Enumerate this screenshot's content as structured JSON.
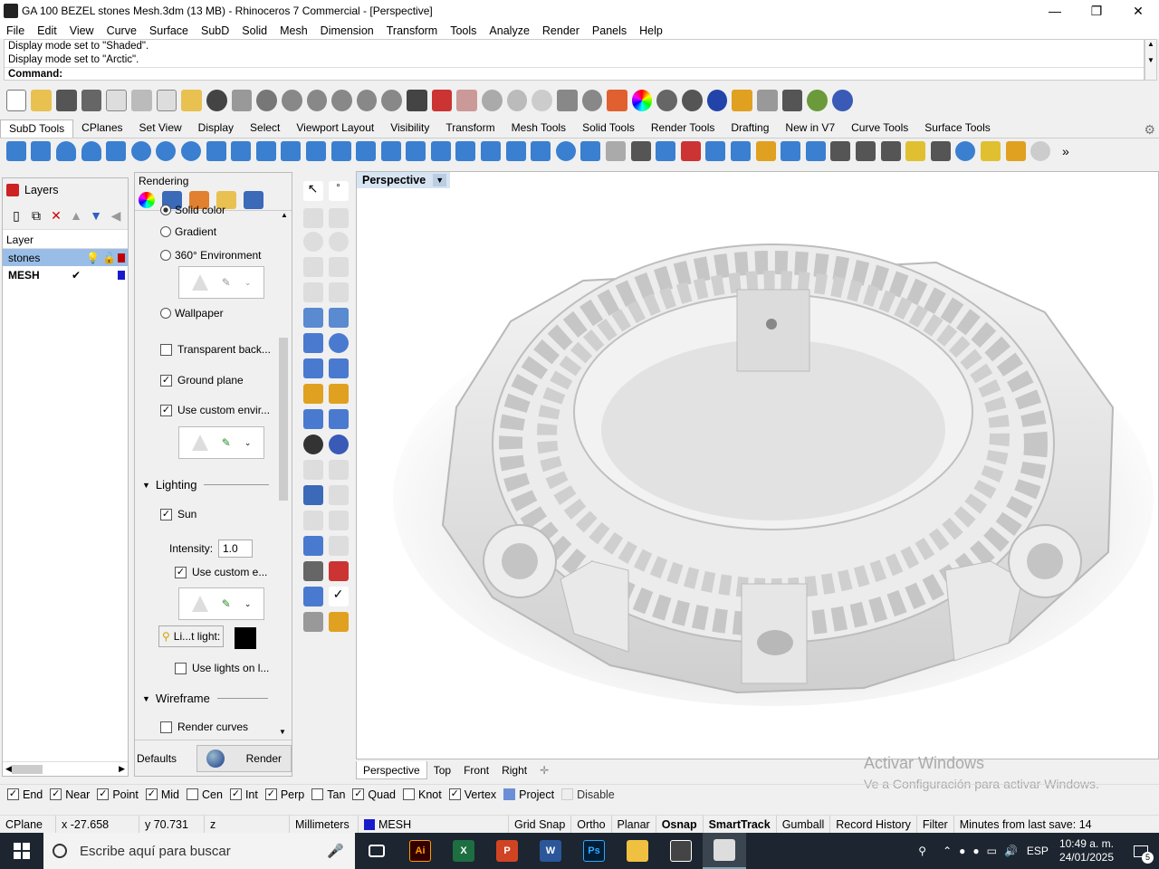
{
  "window": {
    "title": "GA 100 BEZEL stones Mesh.3dm (13 MB) - Rhinoceros 7 Commercial - [Perspective]",
    "minimize": "—",
    "maximize": "❐",
    "close": "✕"
  },
  "menu": [
    "File",
    "Edit",
    "View",
    "Curve",
    "Surface",
    "SubD",
    "Solid",
    "Mesh",
    "Dimension",
    "Transform",
    "Tools",
    "Analyze",
    "Render",
    "Panels",
    "Help"
  ],
  "command_history": {
    "line1": "Display mode set to \"Shaded\".",
    "line2": "Display mode set to \"Arctic\".",
    "prompt": "Command:"
  },
  "toolbar_tabs": [
    "SubD Tools",
    "CPlanes",
    "Set View",
    "Display",
    "Select",
    "Viewport Layout",
    "Visibility",
    "Transform",
    "Mesh Tools",
    "Solid Tools",
    "Render Tools",
    "Drafting",
    "New in V7",
    "Curve Tools",
    "Surface Tools"
  ],
  "layers": {
    "title": "Layers",
    "column_header": "Layer",
    "rows": [
      {
        "name": "stones",
        "selected": true,
        "color": "#c00000"
      },
      {
        "name": "MESH",
        "current": true,
        "color": "#1a1acc"
      }
    ]
  },
  "rendering": {
    "title": "Rendering",
    "solid_color": "Solid color",
    "gradient": "Gradient",
    "env360": "360° Environment",
    "wallpaper": "Wallpaper",
    "transparent": "Transparent back...",
    "ground_plane": "Ground plane",
    "custom_env": "Use custom envir...",
    "lighting": "Lighting",
    "sun": "Sun",
    "intensity_label": "Intensity:",
    "intensity_value": "1.0",
    "custom_e": "Use custom e...",
    "light_label": "Li...t light:",
    "use_lights": "Use lights on l...",
    "wireframe": "Wireframe",
    "render_curves": "Render curves",
    "defaults": "Defaults",
    "render": "Render"
  },
  "viewport": {
    "active": "Perspective",
    "tabs": [
      "Perspective",
      "Top",
      "Front",
      "Right"
    ],
    "add_tab": "✛"
  },
  "watermark": {
    "line1": "Activar Windows",
    "line2": "Ve a Configuración para activar Windows."
  },
  "osnaps": [
    {
      "label": "End",
      "checked": true
    },
    {
      "label": "Near",
      "checked": true
    },
    {
      "label": "Point",
      "checked": true
    },
    {
      "label": "Mid",
      "checked": true
    },
    {
      "label": "Cen",
      "checked": false
    },
    {
      "label": "Int",
      "checked": true
    },
    {
      "label": "Perp",
      "checked": true
    },
    {
      "label": "Tan",
      "checked": false
    },
    {
      "label": "Quad",
      "checked": true
    },
    {
      "label": "Knot",
      "checked": false
    },
    {
      "label": "Vertex",
      "checked": true
    },
    {
      "label": "Project",
      "checked": true
    },
    {
      "label": "Disable",
      "checked": false
    }
  ],
  "status": {
    "cplane": "CPlane",
    "x": "x -27.658",
    "y": "y 70.731",
    "z": "z",
    "units": "Millimeters",
    "layer": "MESH",
    "grid_snap": "Grid Snap",
    "ortho": "Ortho",
    "planar": "Planar",
    "osnap": "Osnap",
    "smarttrack": "SmartTrack",
    "gumball": "Gumball",
    "record_history": "Record History",
    "filter": "Filter",
    "minutes": "Minutes from last save: 14"
  },
  "taskbar": {
    "search_placeholder": "Escribe aquí para buscar",
    "lang": "ESP",
    "time": "10:49 a. m.",
    "date": "24/01/2025",
    "notif_count": "5"
  }
}
